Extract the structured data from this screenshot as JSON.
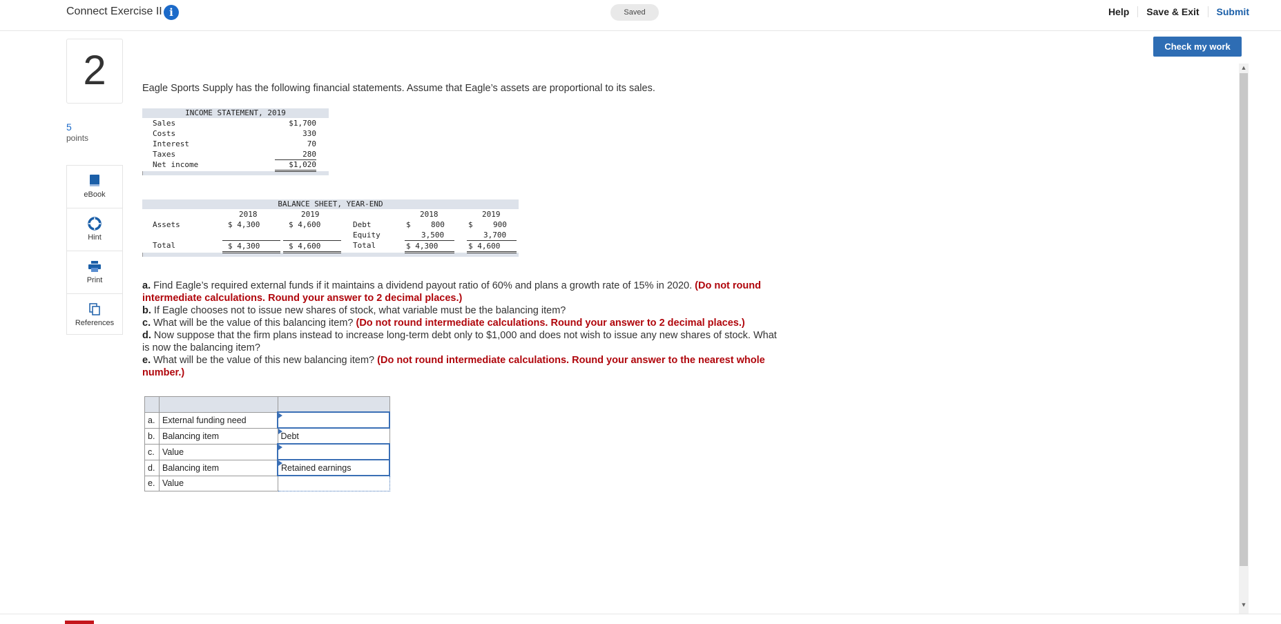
{
  "header": {
    "title": "Connect Exercise II",
    "saved": "Saved",
    "help": "Help",
    "save_exit": "Save & Exit",
    "submit": "Submit",
    "check_work": "Check my work"
  },
  "question": {
    "number": "2",
    "points_value": "5",
    "points_label": "points"
  },
  "tools": [
    {
      "label": "eBook",
      "icon": "book-icon"
    },
    {
      "label": "Hint",
      "icon": "lifebuoy-icon"
    },
    {
      "label": "Print",
      "icon": "printer-icon"
    },
    {
      "label": "References",
      "icon": "copy-icon"
    }
  ],
  "intro": "Eagle Sports Supply has the following financial statements. Assume that Eagle’s assets are proportional to its sales.",
  "income_statement": {
    "title": "INCOME STATEMENT, 2019",
    "rows": [
      {
        "label": "Sales",
        "value": "$1,700"
      },
      {
        "label": "Costs",
        "value": "330"
      },
      {
        "label": "Interest",
        "value": "70"
      },
      {
        "label": "Taxes",
        "value": "280"
      },
      {
        "label": "Net income",
        "value": "$1,020"
      }
    ]
  },
  "balance_sheet": {
    "title": "BALANCE SHEET, YEAR-END",
    "year1": "2018",
    "year2": "2019",
    "assets_label": "Assets",
    "assets_2018": "$ 4,300",
    "assets_2019": "$ 4,600",
    "total_label": "Total",
    "total_assets_2018": "$ 4,300",
    "total_assets_2019": "$ 4,600",
    "debt_label": "Debt",
    "equity_label": "Equity",
    "total2_label": "Total",
    "debt_2018_sym": "$",
    "debt_2018": "800",
    "debt_2019_sym": "$",
    "debt_2019": "900",
    "equity_2018": "3,500",
    "equity_2019": "3,700",
    "total_2018": "$ 4,300",
    "total_2019": "$ 4,600"
  },
  "questions": {
    "a_prefix": "a.",
    "a_text": " Find Eagle’s required external funds if it maintains a dividend payout ratio of 60% and plans a growth rate of 15% in 2020. ",
    "a_red": "(Do not round intermediate calculations. Round your answer to 2 decimal places.)",
    "b_prefix": "b.",
    "b_text": " If Eagle chooses not to issue new shares of stock, what variable must be the balancing item?",
    "c_prefix": "c.",
    "c_text": " What will be the value of this balancing item? ",
    "c_red": "(Do not round intermediate calculations. Round your answer to 2 decimal places.)",
    "d_prefix": "d.",
    "d_text": " Now suppose that the firm plans instead to increase long-term debt only to $1,000 and does not wish to issue any new shares of stock. What is now the balancing item?",
    "e_prefix": "e.",
    "e_text": " What will be the value of this new balancing item? ",
    "e_red": "(Do not round intermediate calculations. Round your answer to the nearest whole number.)"
  },
  "answers": [
    {
      "letter": "a.",
      "label": "External funding need",
      "value": ""
    },
    {
      "letter": "b.",
      "label": "Balancing item",
      "value": "Debt"
    },
    {
      "letter": "c.",
      "label": "Value",
      "value": ""
    },
    {
      "letter": "d.",
      "label": "Balancing item",
      "value": "Retained earnings"
    },
    {
      "letter": "e.",
      "label": "Value",
      "value": ""
    }
  ]
}
